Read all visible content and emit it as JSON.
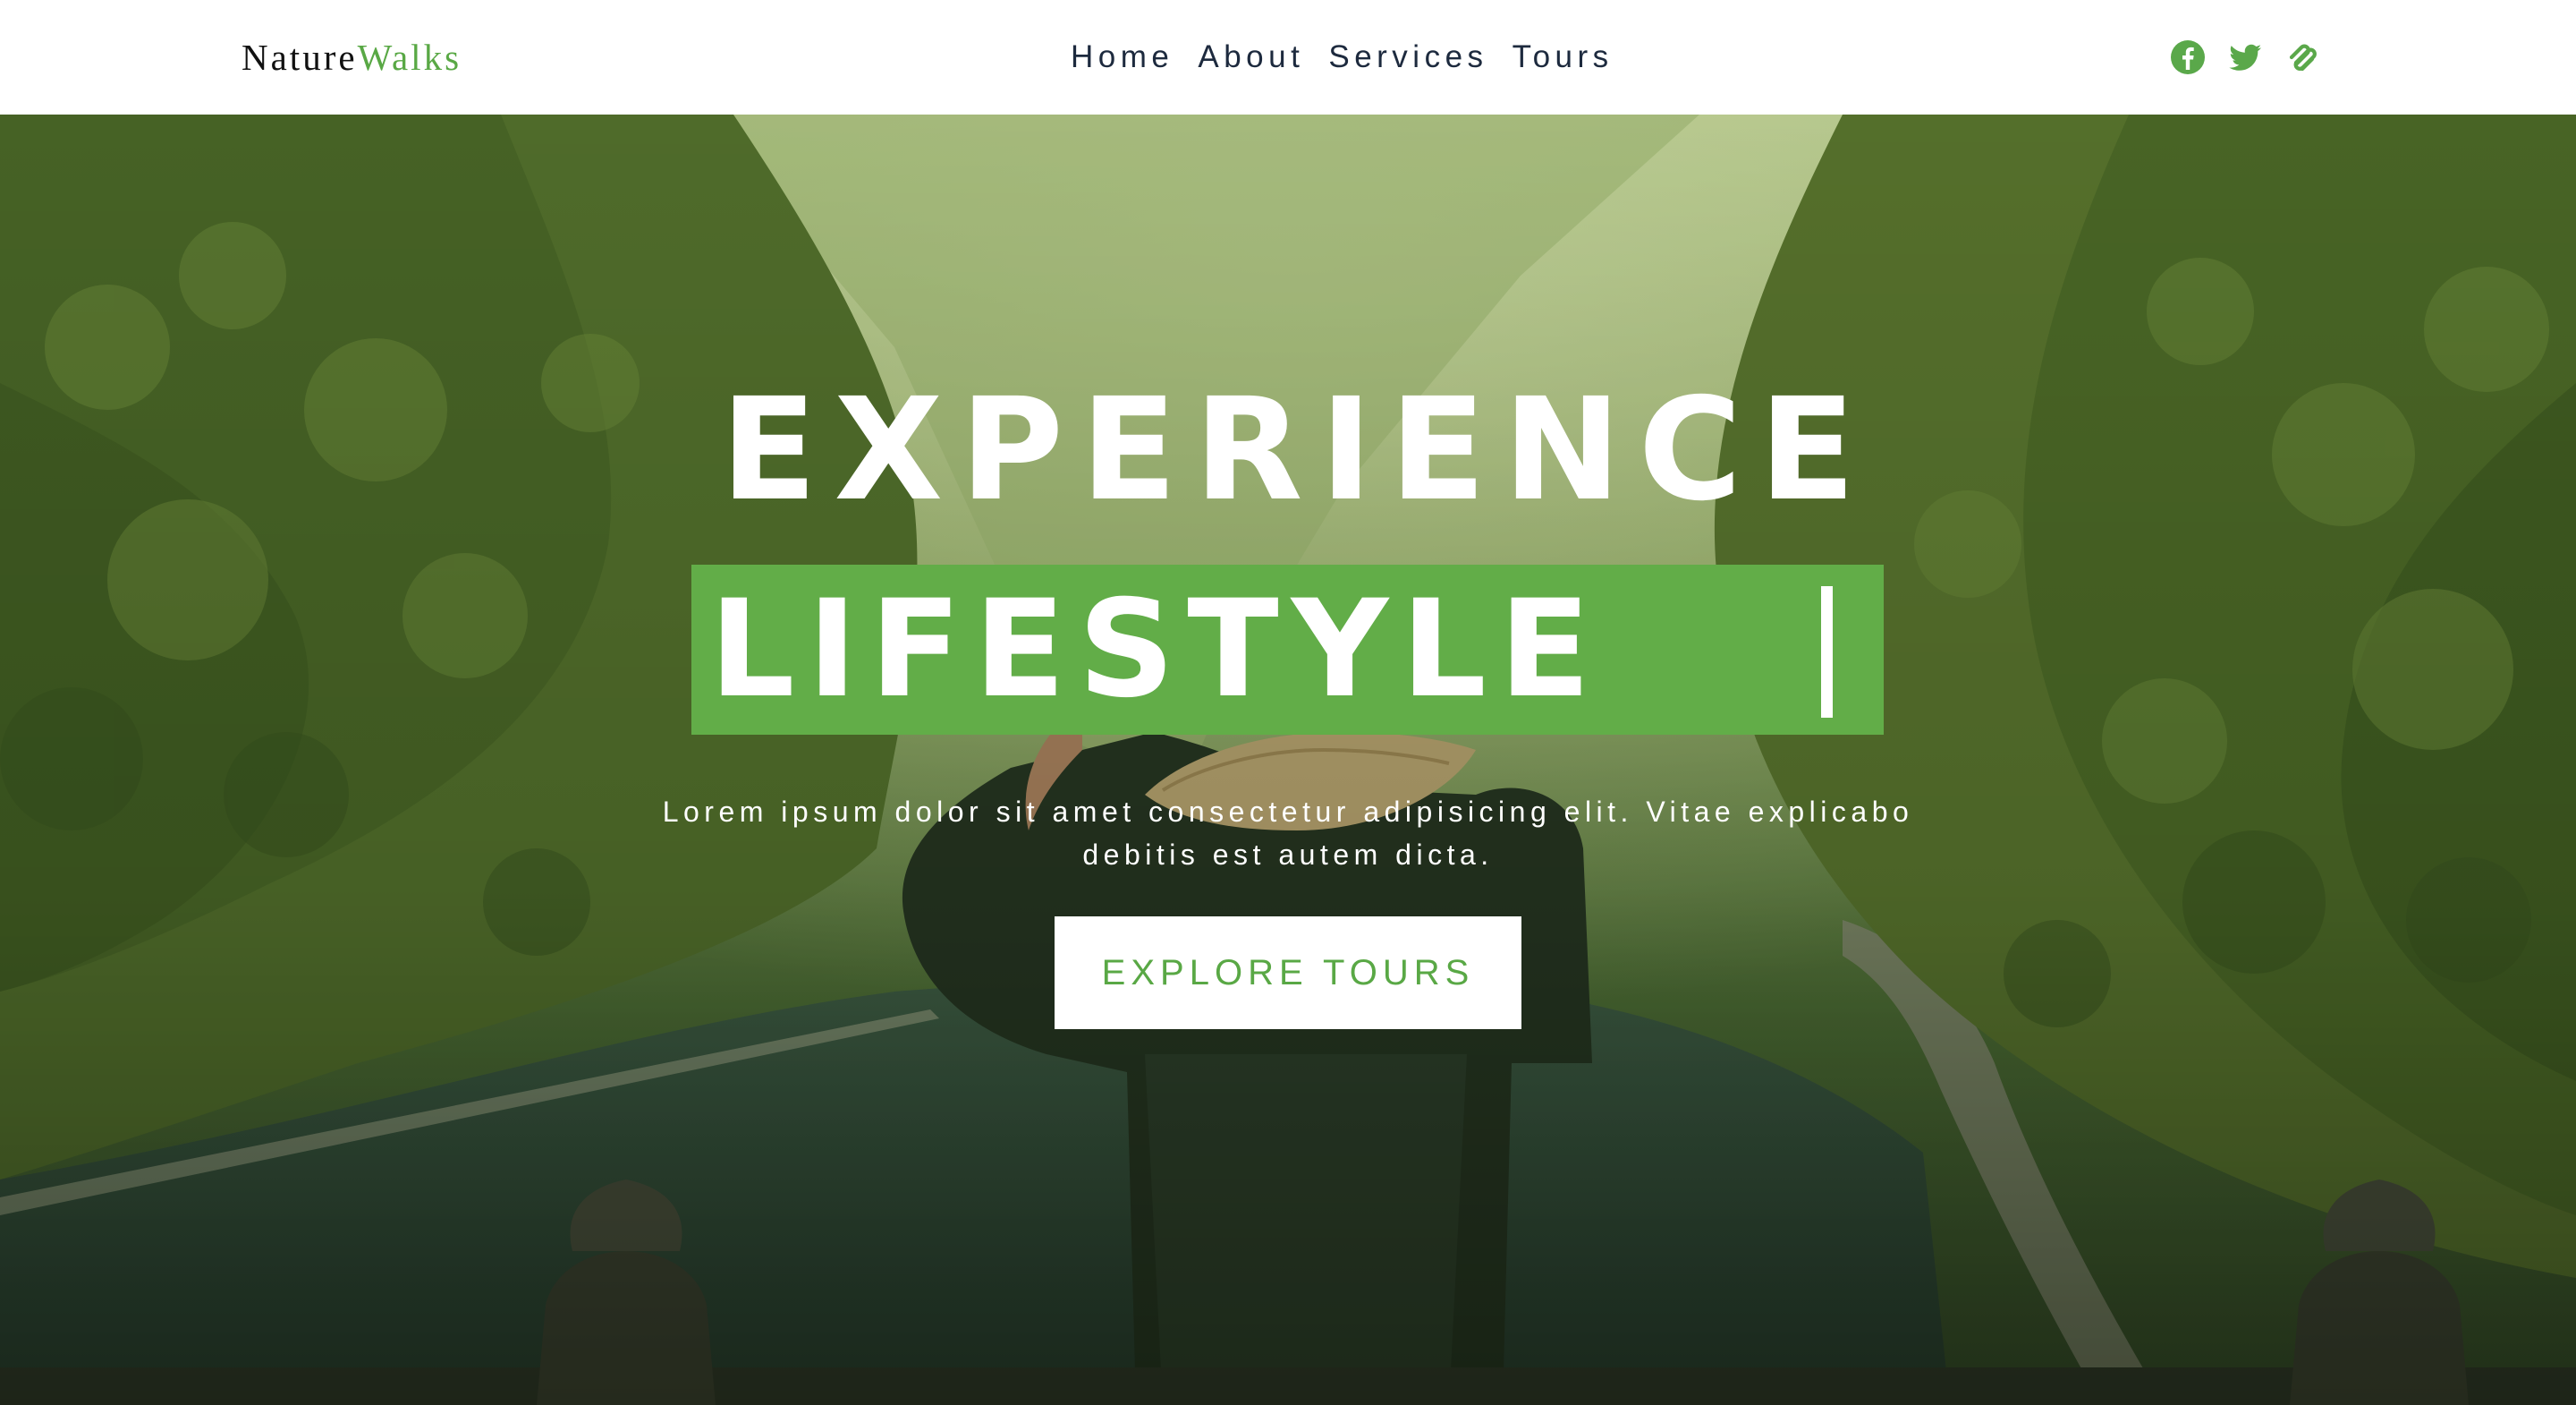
{
  "brand": {
    "name_part1": "Nature",
    "name_part2": "Walks",
    "accent_color": "#59a845"
  },
  "nav": {
    "items": [
      {
        "label": "Home"
      },
      {
        "label": "About"
      },
      {
        "label": "Services"
      },
      {
        "label": "Tours"
      }
    ]
  },
  "social": {
    "icons": [
      "facebook-icon",
      "twitter-icon",
      "squarespace-icon"
    ],
    "icon_color": "#5aa84a"
  },
  "hero": {
    "headline_line1": "EXPERIENCE",
    "headline_line2": "LIFESTYLE",
    "highlight_color": "#62ad48",
    "subtitle": "Lorem ipsum dolor sit amet consectetur adipisicing elit. Vitae explicabo debitis est autem dicta.",
    "cta_label": "EXPLORE TOURS",
    "background_image": "traveler-in-conical-hat-overlooking-green-valley-river"
  }
}
